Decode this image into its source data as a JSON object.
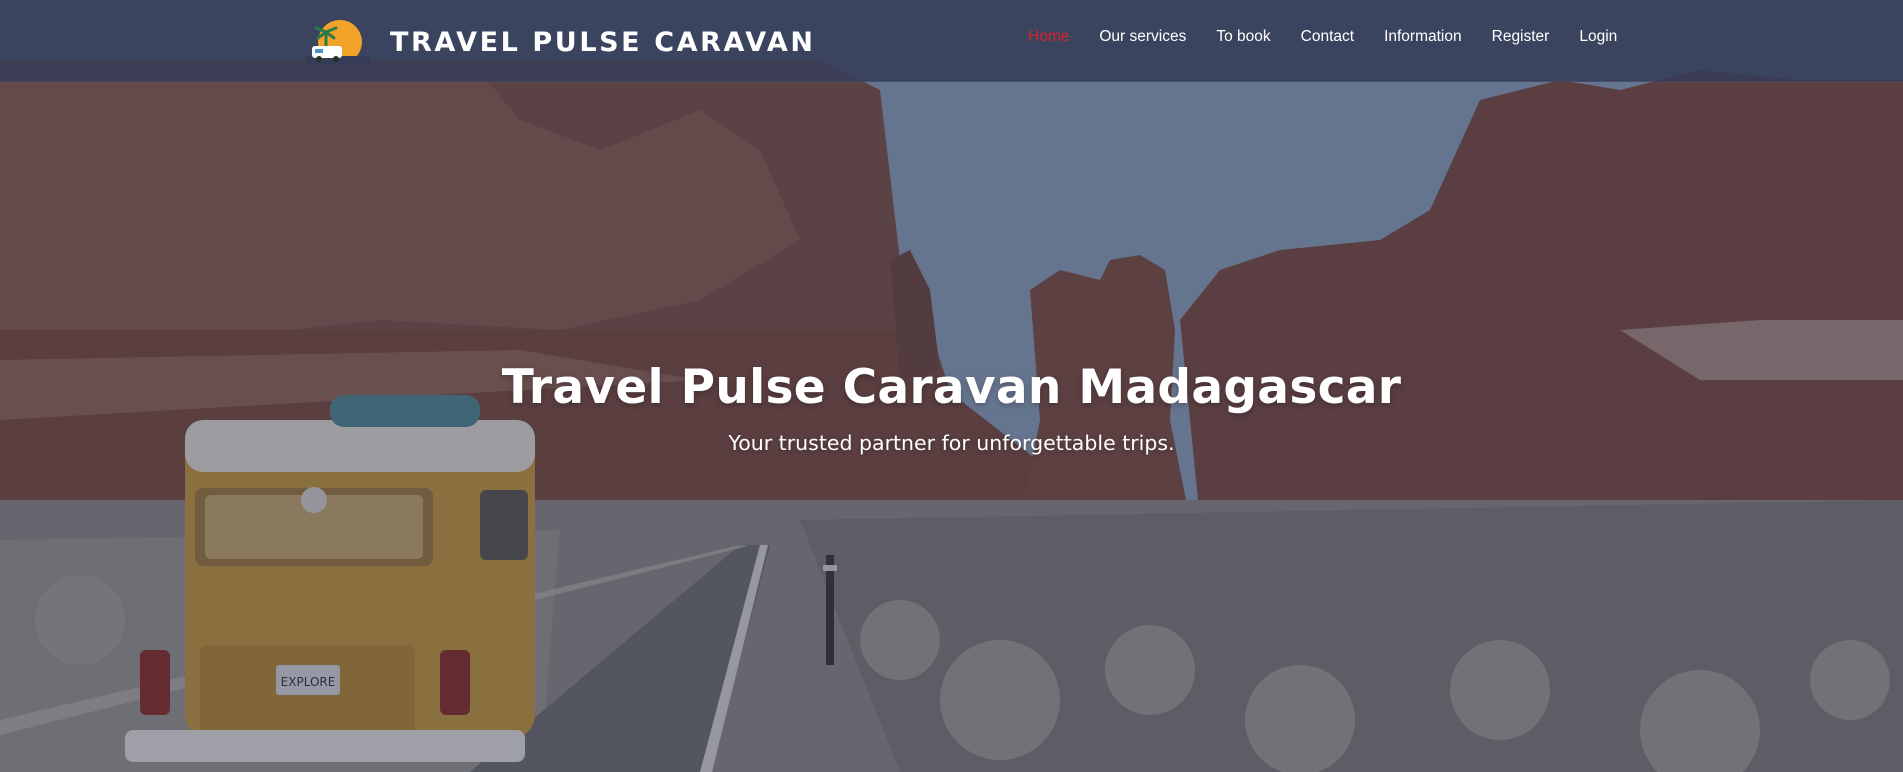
{
  "header": {
    "brand_name": "TRAVEL PULSE CARAVAN",
    "logo_icon": "caravan-sunset-logo"
  },
  "nav": {
    "items": [
      {
        "label": "Home",
        "active": true
      },
      {
        "label": "Our services",
        "active": false
      },
      {
        "label": "To book",
        "active": false
      },
      {
        "label": "Contact",
        "active": false
      },
      {
        "label": "Information",
        "active": false
      },
      {
        "label": "Register",
        "active": false
      },
      {
        "label": "Login",
        "active": false
      }
    ]
  },
  "hero": {
    "title": "Travel Pulse Caravan Madagascar",
    "subtitle": "Your trusted partner for unforgettable trips.",
    "license_plate": "EXPLORE"
  },
  "colors": {
    "active_nav": "#d6232a",
    "navbar_bg": "#343c56",
    "text": "#ffffff"
  }
}
